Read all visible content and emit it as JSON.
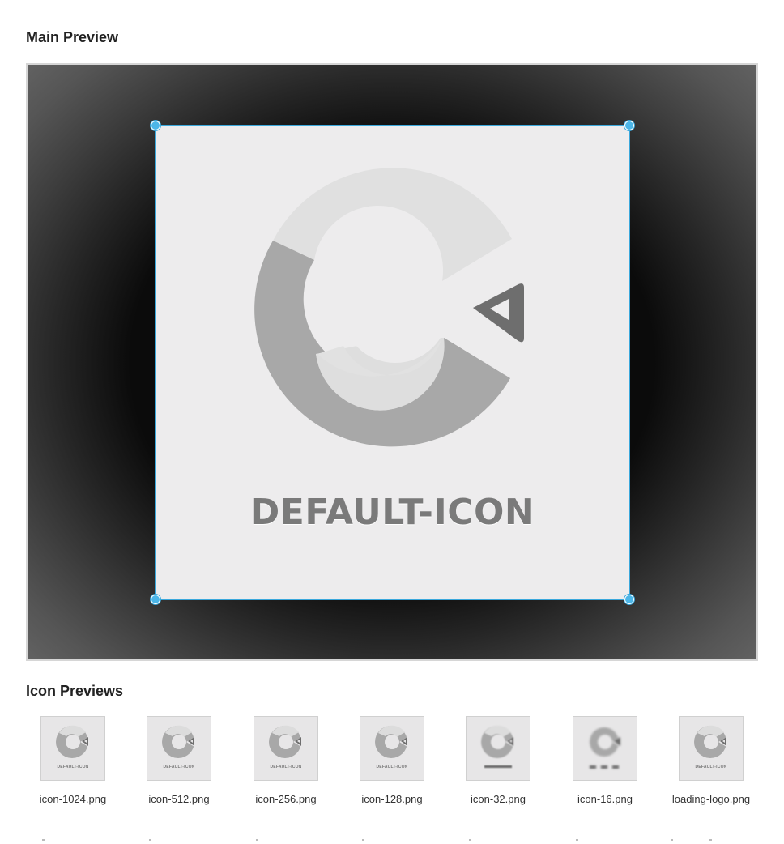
{
  "sections": {
    "main_preview_title": "Main Preview",
    "icon_previews_title": "Icon Previews"
  },
  "main_preview": {
    "logo_text": "DEFAULT-ICON"
  },
  "thumbnails": [
    {
      "filename": "icon-1024.png",
      "caption": "DEFAULT-ICON"
    },
    {
      "filename": "icon-512.png",
      "caption": "DEFAULT-ICON"
    },
    {
      "filename": "icon-256.png",
      "caption": "DEFAULT-ICON"
    },
    {
      "filename": "icon-128.png",
      "caption": "DEFAULT-ICON"
    },
    {
      "filename": "icon-32.png",
      "caption": ""
    },
    {
      "filename": "icon-16.png",
      "caption": ""
    },
    {
      "filename": "loading-logo.png",
      "caption": "DEFAULT-ICON"
    }
  ],
  "colors": {
    "accent": "#3aa8dc",
    "logo_light": "#e0e0e0",
    "logo_mid": "#a9a9a9",
    "logo_dark": "#6e6e6e"
  }
}
